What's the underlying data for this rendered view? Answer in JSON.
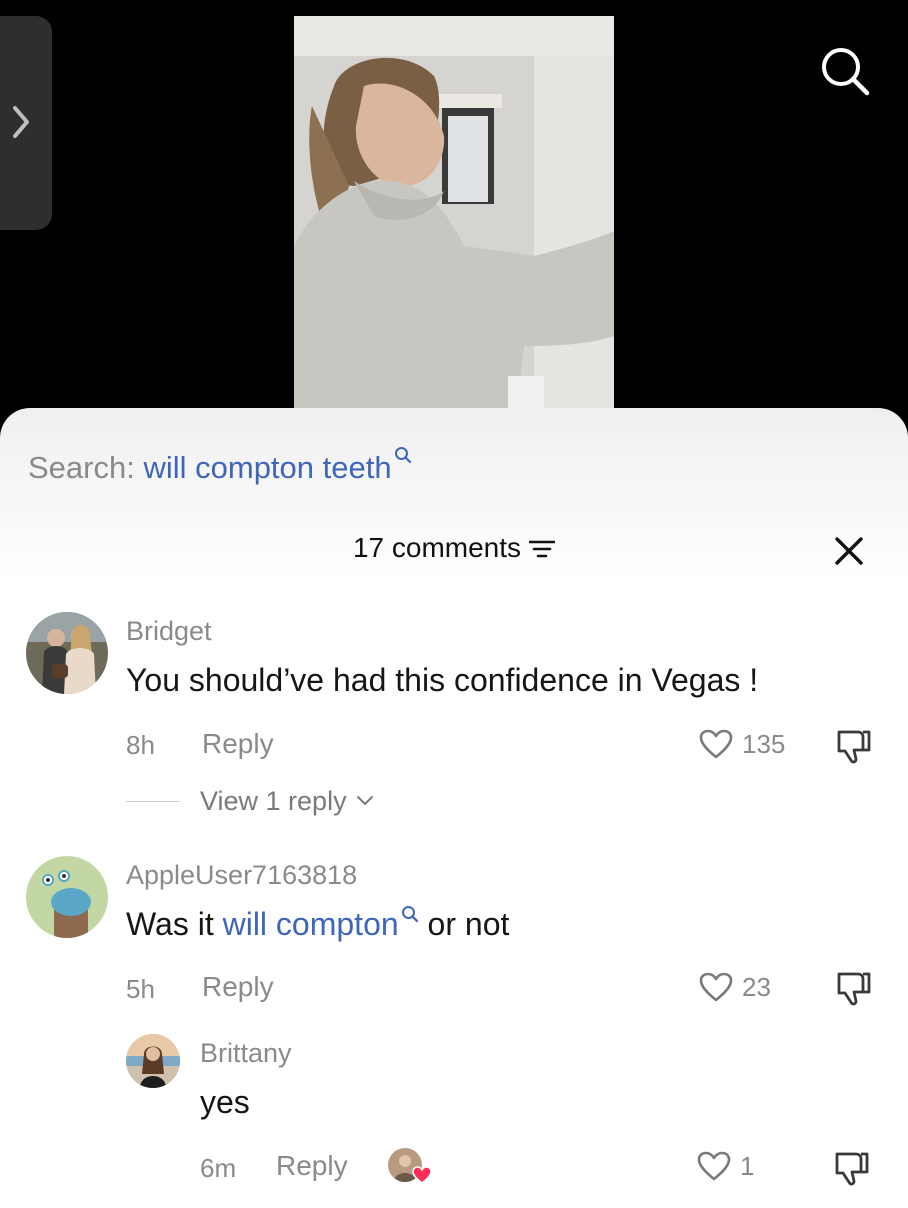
{
  "search": {
    "prefix": "Search:",
    "query": "will compton teeth"
  },
  "header": {
    "count_label": "17 comments"
  },
  "comments": [
    {
      "user": "Bridget",
      "text": "You should’ve had this confidence in Vegas !",
      "time": "8h",
      "reply_label": "Reply",
      "likes": "135",
      "view_replies": "View 1 reply"
    },
    {
      "user": "AppleUser7163818",
      "text_before": "Was it ",
      "text_link": "will compton",
      "text_after": " or not",
      "time": "5h",
      "reply_label": "Reply",
      "likes": "23"
    }
  ],
  "reply": {
    "user": "Brittany",
    "text": "yes",
    "time": "6m",
    "reply_label": "Reply",
    "likes": "1"
  },
  "colors": {
    "link": "#3f66b8",
    "secondary_text": "#8a8a8a",
    "primary_text": "#161616",
    "creator_heart": "#ff2d55"
  }
}
